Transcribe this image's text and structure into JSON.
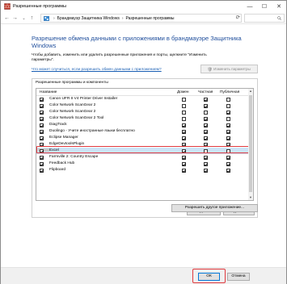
{
  "window": {
    "title": "Разрешенные программы",
    "minimize": "—",
    "maximize": "☐",
    "close": "✕"
  },
  "address": {
    "parts": [
      "Брандмауэр Защитника Windows",
      "Разрешенные программы"
    ],
    "separator": "›",
    "dropdown": "⌄",
    "refresh": "⟳"
  },
  "content": {
    "heading": "Разрешение обмена данными с приложениями в брандмауэре Защитника Windows",
    "description": "Чтобы добавить, изменить или удалить разрешенные приложения и порты, щелкните \"Изменить параметры\".",
    "risk_link": "Что может случиться, если разрешить обмен данными с приложением?",
    "change_settings": "Изменить параметры"
  },
  "group": {
    "label": "Разрешенные программы и компоненты",
    "columns": {
      "name": "Название",
      "domain": "Домен",
      "private": "Частная",
      "public": "Публичная"
    },
    "rows": [
      {
        "name": "Canon UFR II V4 Printer Driver Installer",
        "enabled": true,
        "domain": false,
        "private": true,
        "public": false
      },
      {
        "name": "Color Network ScanGear 2",
        "enabled": true,
        "domain": false,
        "private": true,
        "public": false
      },
      {
        "name": "Color Network ScanGear 2",
        "enabled": true,
        "domain": false,
        "private": false,
        "public": true
      },
      {
        "name": "Color Network ScanGear 2 Tool",
        "enabled": true,
        "domain": false,
        "private": true,
        "public": false
      },
      {
        "name": "DiagTrack",
        "enabled": true,
        "domain": true,
        "private": true,
        "public": true
      },
      {
        "name": "Duolingo - Учите иностранные языки бесплатно",
        "enabled": true,
        "domain": true,
        "private": true,
        "public": true
      },
      {
        "name": "Eclipse Manager",
        "enabled": true,
        "domain": true,
        "private": true,
        "public": true
      },
      {
        "name": "EdgeDevtoolsPlugin",
        "enabled": true,
        "domain": true,
        "private": true,
        "public": true
      },
      {
        "name": "Excel",
        "enabled": true,
        "domain": true,
        "private": false,
        "public": false,
        "selected": true
      },
      {
        "name": "Farmville 2: Country Escape",
        "enabled": true,
        "domain": true,
        "private": true,
        "public": true
      },
      {
        "name": "Feedback Hub",
        "enabled": true,
        "domain": true,
        "private": true,
        "public": true
      },
      {
        "name": "Flipboard",
        "enabled": true,
        "domain": true,
        "private": true,
        "public": true
      }
    ],
    "details": "Сведения...",
    "delete": "Удалить"
  },
  "allow_other": "Разрешить другое приложение...",
  "footer": {
    "ok": "ОК",
    "cancel": "Отмена"
  }
}
